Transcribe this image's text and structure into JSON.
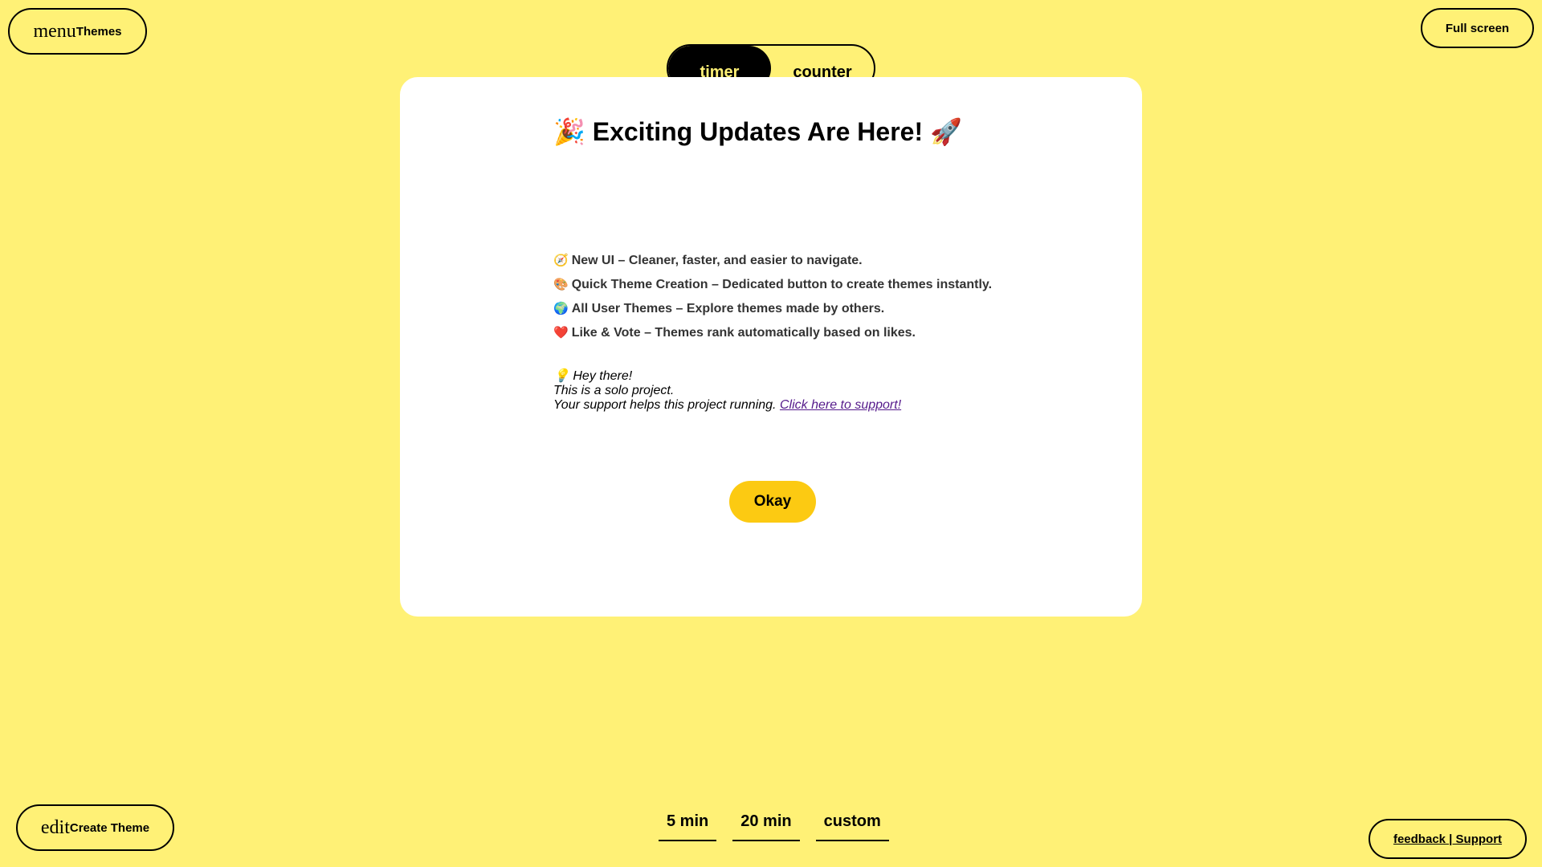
{
  "header": {
    "themes_icon": "menu",
    "themes_label": "Themes",
    "fullscreen_label": "Full screen"
  },
  "mode_tabs": {
    "timer": "timer",
    "counter": "counter",
    "active": "timer"
  },
  "modal": {
    "title_emoji_left": "🎉",
    "title": "Exciting Updates Are Here!",
    "title_emoji_right": "🚀",
    "features": [
      {
        "emoji": "🧭",
        "text": "New UI – Cleaner, faster, and easier to navigate."
      },
      {
        "emoji": "🎨",
        "text": "Quick Theme Creation – Dedicated button to create themes instantly."
      },
      {
        "emoji": "🌍",
        "text": "All User Themes – Explore themes made by others."
      },
      {
        "emoji": "❤️",
        "text": "Like & Vote – Themes rank automatically based on likes."
      }
    ],
    "note_emoji": "💡",
    "note_line1": "Hey there!",
    "note_line2": "This is a solo project.",
    "note_line3": "Your support helps this project running.",
    "support_link": "Click here to support!",
    "okay_label": "Okay"
  },
  "presets": [
    "5 min",
    "20 min",
    "custom"
  ],
  "footer": {
    "create_icon": "edit",
    "create_label": "Create Theme",
    "feedback_label": "feedback | Support"
  },
  "colors": {
    "background": "#FFF176",
    "modal": "#FFFFFF",
    "accent_button": "#FCCA12",
    "active_tab": "#000000"
  }
}
